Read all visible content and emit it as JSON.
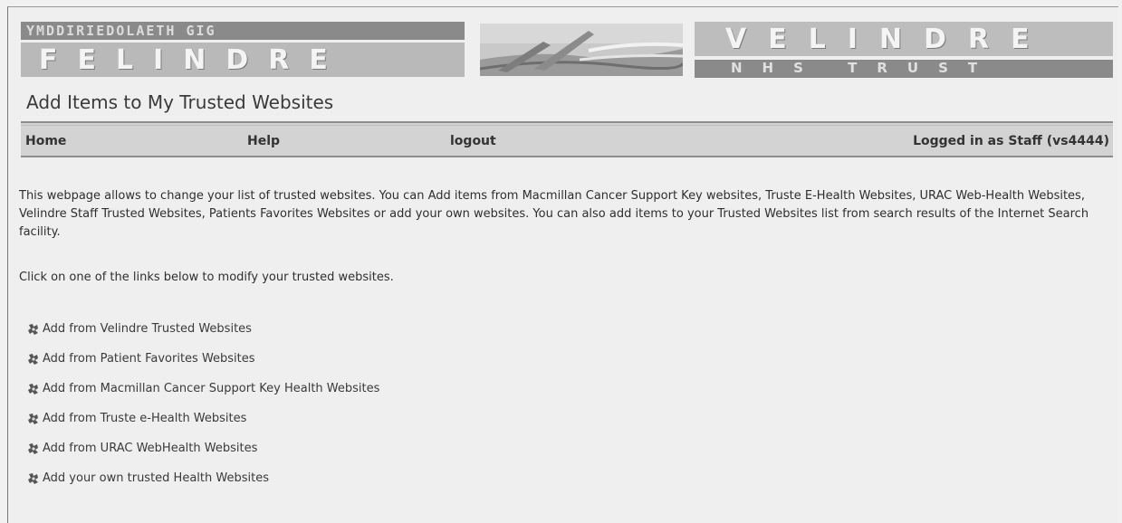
{
  "banner": {
    "left_top_text": "YMDDIRIEDOLAETH GIG",
    "left_main_text": "FELINDRE",
    "right_main_text": "VELINDRE",
    "right_sub_text": "NHS TRUST"
  },
  "page_title": "Add Items to My Trusted Websites",
  "nav": {
    "home": "Home",
    "help": "Help",
    "logout": "logout",
    "status": "Logged in as Staff (vs4444)"
  },
  "intro": "This webpage allows to change your list of trusted websites. You can Add items from Macmillan Cancer Support Key websites, Truste E-Health Websites, URAC Web-Health Websites, Velindre Staff Trusted Websites, Patients Favorites Websites or add your own websites. You can also add items to your Trusted Websites list from search results of the Internet Search facility.",
  "instruction": "Click on one of the links below to modify your trusted websites.",
  "links": [
    {
      "label": "Add from Velindre Trusted Websites",
      "icon": "stamp-icon"
    },
    {
      "label": "Add from Patient Favorites Websites",
      "icon": "stamp-icon"
    },
    {
      "label": "Add from Macmillan Cancer Support Key Health Websites",
      "icon": "stamp-icon"
    },
    {
      "label": "Add from Truste e-Health Websites",
      "icon": "stamp-icon"
    },
    {
      "label": "Add from URAC WebHealth Websites",
      "icon": "stamp-icon"
    },
    {
      "label": "Add your own trusted Health Websites",
      "icon": "stamp-icon"
    }
  ]
}
